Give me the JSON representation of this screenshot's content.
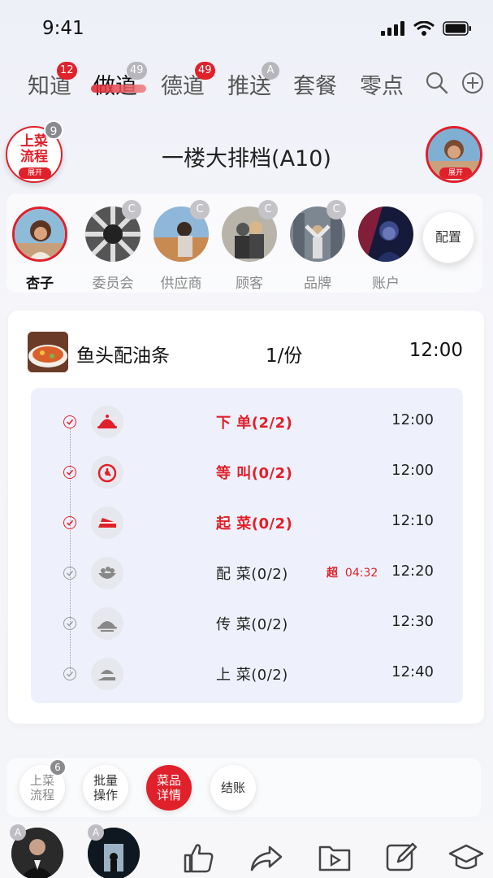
{
  "status": {
    "time": "9:41"
  },
  "tabs": [
    {
      "label": "知道",
      "badge": "12"
    },
    {
      "label": "做道",
      "badge": "49",
      "active": true
    },
    {
      "label": "德道",
      "badge": "49"
    },
    {
      "label": "推送",
      "badge": "A"
    },
    {
      "label": "套餐"
    },
    {
      "label": "零点"
    }
  ],
  "header": {
    "flow_label_line1": "上菜",
    "flow_label_line2": "流程",
    "flow_pill": "展开",
    "flow_count": "9",
    "title": "一楼大排档(A10)",
    "avatar_pill": "展开"
  },
  "people": [
    {
      "name": "杏子",
      "selected": true
    },
    {
      "name": "委员会",
      "badge": "C"
    },
    {
      "name": "供应商",
      "badge": "C"
    },
    {
      "name": "顾客",
      "badge": "C"
    },
    {
      "name": "品牌",
      "badge": "C"
    },
    {
      "name": "账户"
    }
  ],
  "config_label": "配置",
  "dish": {
    "name": "鱼头配油条",
    "qty": "1/份",
    "time": "12:00"
  },
  "steps": [
    {
      "label": "下 单(2/2)",
      "time": "12:00",
      "done": true,
      "icon": "cloche-icon"
    },
    {
      "label": "等 叫(0/2)",
      "time": "12:00",
      "done": true,
      "icon": "timer-icon"
    },
    {
      "label": "起 菜(0/2)",
      "time": "12:10",
      "done": true,
      "icon": "cake-slice-icon"
    },
    {
      "label": "配 菜(0/2)",
      "time": "12:20",
      "done": false,
      "late_label": "超",
      "late_time": "04:32",
      "icon": "salad-bowl-icon"
    },
    {
      "label": "传 菜(0/2)",
      "time": "12:30",
      "done": false,
      "icon": "serving-dome-icon"
    },
    {
      "label": "上 菜(0/2)",
      "time": "12:40",
      "done": false,
      "icon": "serve-hand-icon"
    }
  ],
  "actions": {
    "flow_line1": "上菜",
    "flow_line2": "流程",
    "flow_count": "6",
    "batch_line1": "批量",
    "batch_line2": "操作",
    "detail_line1": "菜品",
    "detail_line2": "详情",
    "checkout": "结账"
  },
  "bottom": {
    "badge1": "A",
    "badge2": "A"
  },
  "colors": {
    "accent": "#e0202a"
  }
}
